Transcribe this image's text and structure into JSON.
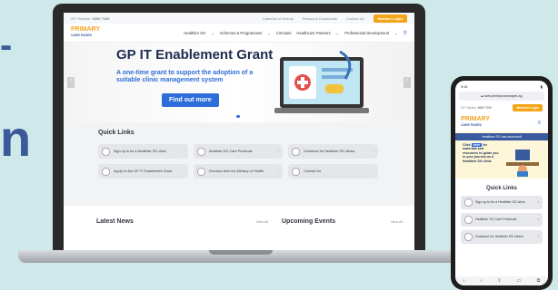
{
  "laptop_site": {
    "util": {
      "phone_label": "GP Helpline:",
      "phone": "6650 7199",
      "links": [
        "Calendar of Events",
        "Resource Downloads",
        "Contact Us"
      ],
      "login": "Member Login"
    },
    "logo": {
      "line1": "PRIMARY",
      "line2": "CARE PAGES"
    },
    "nav": [
      "Healthier SG",
      "Schemes & Programmes",
      "Circulars",
      "Healthcare Partners",
      "Professional Development"
    ],
    "hero": {
      "title": "GP IT Enablement Grant",
      "subtitle": "A one-time grant to support the adoption of a suitable clinic management system",
      "cta": "Find out more"
    },
    "quick_links": {
      "title": "Quick Links",
      "items": [
        "Sign up to be a Healthier SG clinic",
        "Healthier SG Care Protocols",
        "Guidance for Healthier SG clinics",
        "Apply for the GP IT Enablement Grant",
        "Circulars from the Ministry of Health",
        "Contact Us"
      ]
    },
    "latest_news": {
      "title": "Latest News",
      "view_all": "View All"
    },
    "upcoming_events": {
      "title": "Upcoming Events",
      "view_all": "View All"
    }
  },
  "phone_site": {
    "status": {
      "time": "9:41"
    },
    "url": "www.primarycarepages.sg",
    "util": {
      "phone_label": "GP Helpline:",
      "phone": "6650 7199",
      "login": "Member Login"
    },
    "logo": {
      "line1": "PRIMARY",
      "line2": "CARE PAGES"
    },
    "banner": {
      "title": "Healthier SG has launched!",
      "text_pre": "Click",
      "text_here": "here",
      "text_post": "for materials and resources to guide you in your journey as a Healthier SG clinic"
    },
    "quick_links": {
      "title": "Quick Links",
      "items": [
        "Sign up to be a Healthier SG clinic",
        "Healthier SG Care Protocols",
        "Guidance for Healthier SG clinics"
      ]
    }
  },
  "edge_text": {
    "dash": "-",
    "n": "n"
  }
}
